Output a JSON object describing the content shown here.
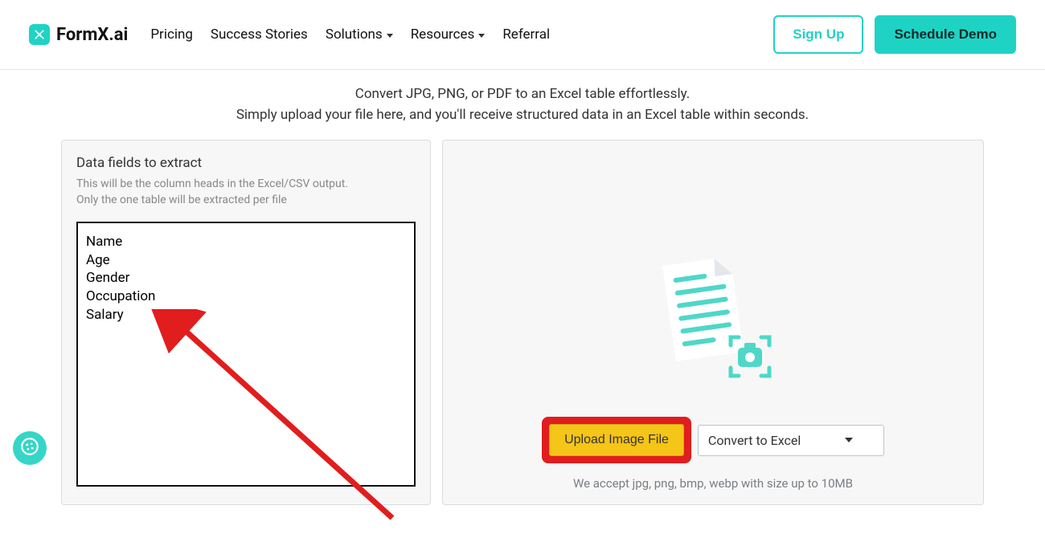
{
  "brand": {
    "name": "FormX.ai"
  },
  "nav": {
    "pricing": "Pricing",
    "success_stories": "Success Stories",
    "solutions": "Solutions",
    "resources": "Resources",
    "referral": "Referral"
  },
  "cta": {
    "sign_up": "Sign Up",
    "schedule_demo": "Schedule Demo"
  },
  "hero": {
    "line1": "Convert JPG, PNG, or PDF to an Excel table effortlessly.",
    "line2": "Simply upload your file here, and you'll receive structured data in an Excel table within seconds."
  },
  "left_panel": {
    "title": "Data fields to extract",
    "hint": "This will be the column heads in the Excel/CSV output.\nOnly the one table will be extracted per file",
    "fields_text": "Name\nAge\nGender\nOccupation\nSalary"
  },
  "upload": {
    "button": "Upload Image File",
    "convert_label": "Convert to Excel",
    "accept_note": "We accept jpg, png, bmp, webp with size up to 10MB"
  },
  "colors": {
    "accent": "#1fd3c4",
    "upload_button_bg": "#f5c518",
    "annotation_red": "#e11d1d"
  }
}
